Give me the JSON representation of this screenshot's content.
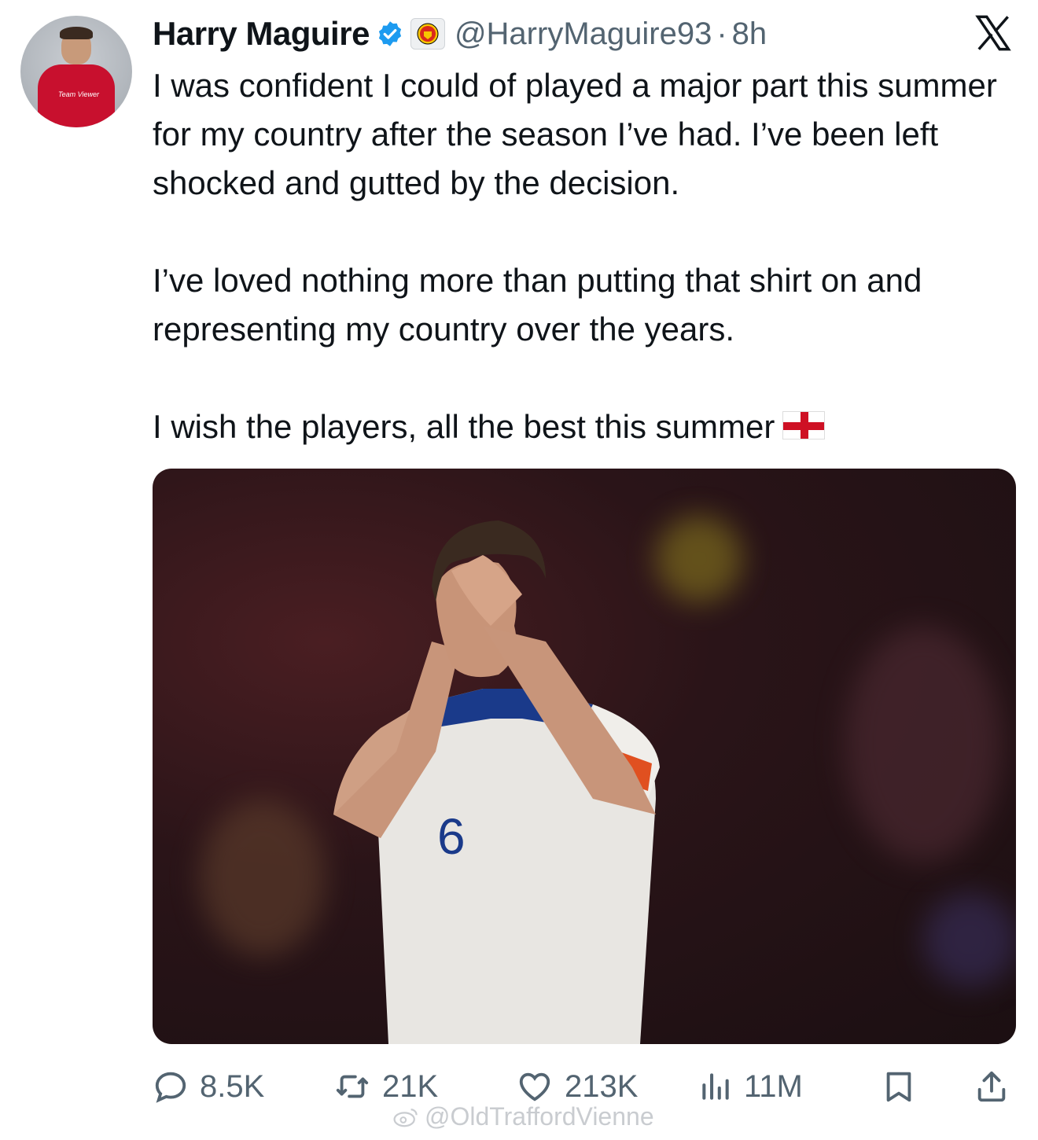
{
  "author": {
    "name": "Harry Maguire",
    "handle": "@HarryMaguire93",
    "separator": "·",
    "time": "8h",
    "avatar_sponsor": "Team\nViewer"
  },
  "tweet": {
    "paragraph_1": "I was confident I could of played a major part this summer for my country after the season I’ve had. I’ve been left shocked and gutted by the decision.",
    "paragraph_2": "I’ve loved nothing more than putting that shirt on and representing my country over the years.",
    "paragraph_3": "I wish the players, all the best this summer"
  },
  "media": {
    "shirt_number": "6"
  },
  "actions": {
    "replies": "8.5K",
    "reposts": "21K",
    "likes": "213K",
    "views": "11M"
  },
  "watermark": "@OldTraffordVienne",
  "colors": {
    "text": "#0f1419",
    "secondary": "#536471",
    "verified": "#1d9bf0",
    "accent_red": "#c8102e"
  },
  "icons": [
    "verified-badge-icon",
    "man-utd-affiliate-icon",
    "x-logo-icon",
    "reply-icon",
    "repost-icon",
    "like-icon",
    "views-icon",
    "bookmark-icon",
    "share-icon",
    "weibo-icon",
    "england-flag-icon"
  ]
}
